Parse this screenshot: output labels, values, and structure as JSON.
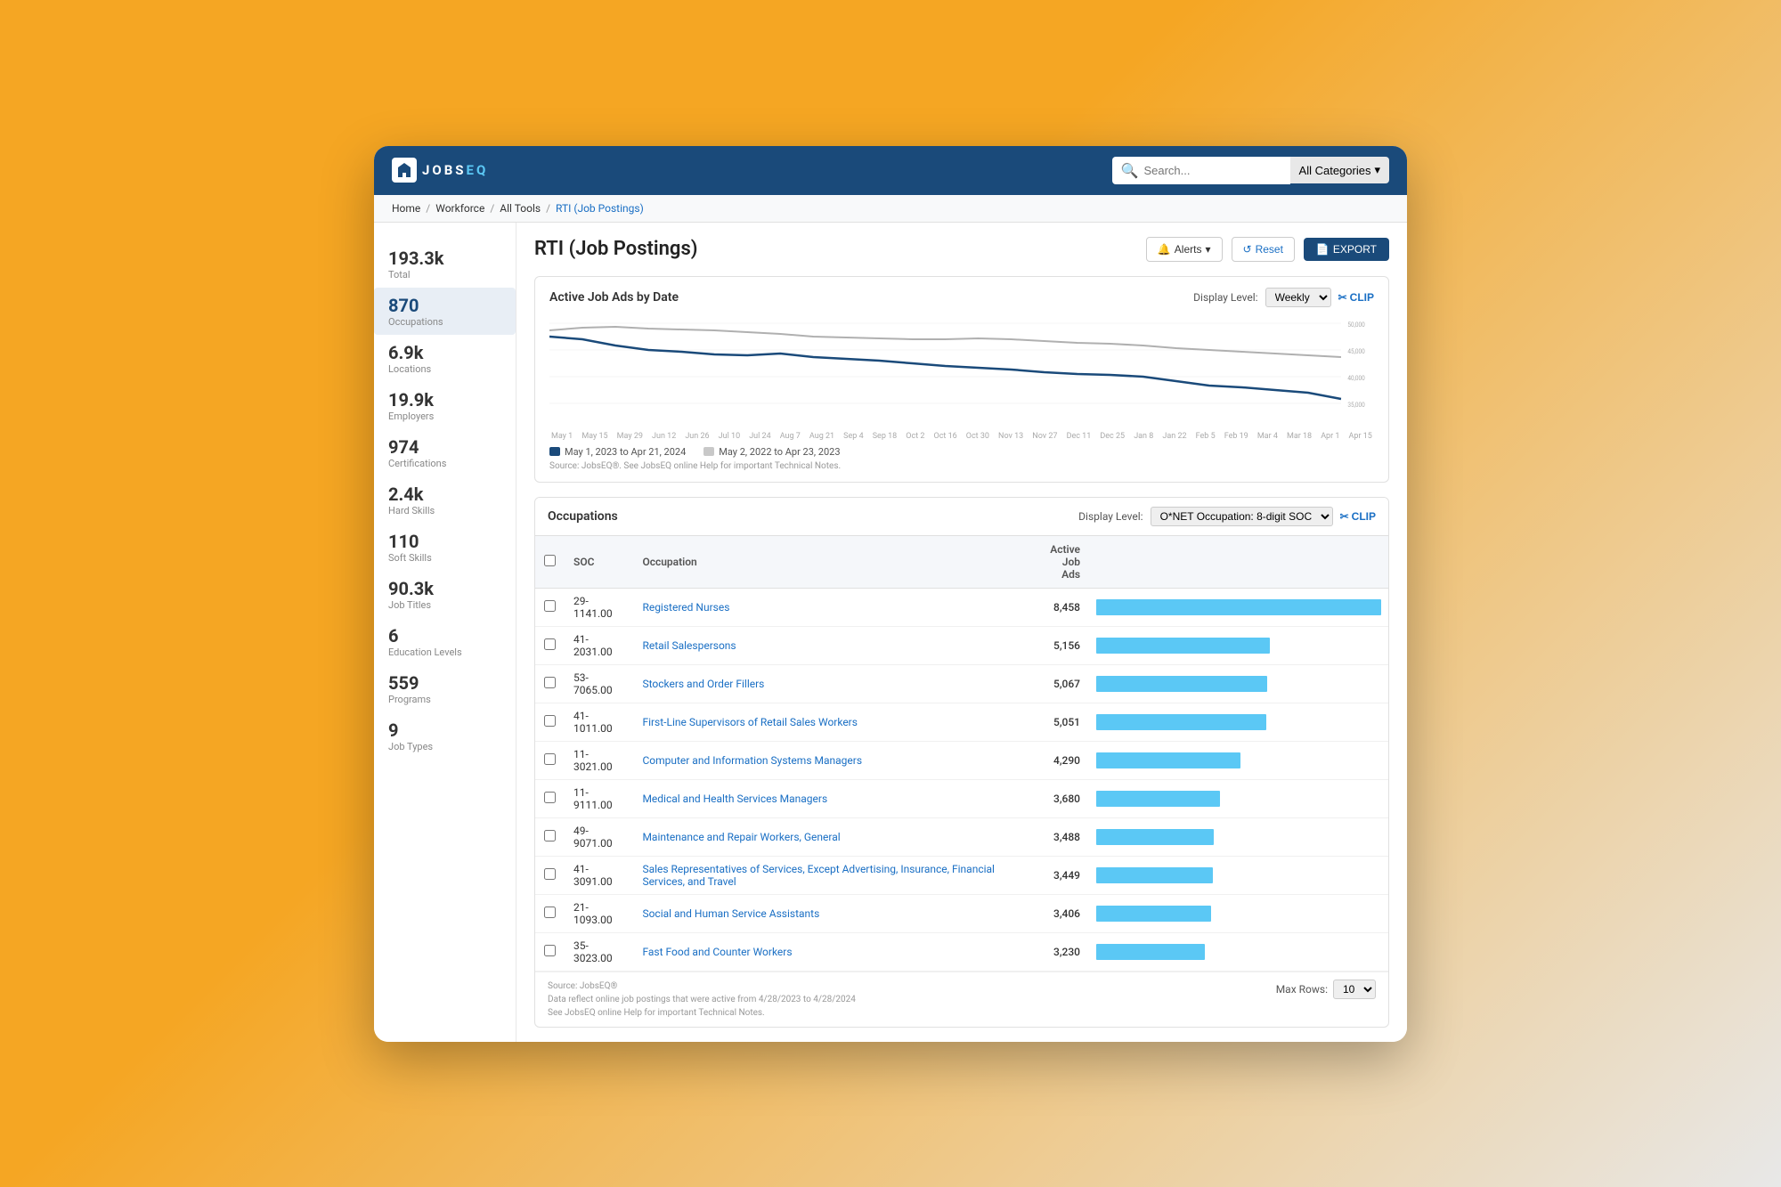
{
  "app": {
    "logo_text": "JOBS",
    "logo_eq": "EQ",
    "search_placeholder": "Search...",
    "search_category": "All Categories"
  },
  "breadcrumb": {
    "items": [
      "Home",
      "Workforce",
      "All Tools",
      "RTI (Job Postings)"
    ]
  },
  "page": {
    "title": "RTI (Job Postings)",
    "alerts_label": "Alerts",
    "reset_label": "Reset",
    "export_label": "EXPORT"
  },
  "sidebar": {
    "items": [
      {
        "value": "193.3k",
        "label": "Total"
      },
      {
        "value": "870",
        "label": "Occupations",
        "active": true
      },
      {
        "value": "6.9k",
        "label": "Locations"
      },
      {
        "value": "19.9k",
        "label": "Employers"
      },
      {
        "value": "974",
        "label": "Certifications"
      },
      {
        "value": "2.4k",
        "label": "Hard Skills"
      },
      {
        "value": "110",
        "label": "Soft Skills"
      },
      {
        "value": "90.3k",
        "label": "Job Titles"
      },
      {
        "value": "6",
        "label": "Education Levels"
      },
      {
        "value": "559",
        "label": "Programs"
      },
      {
        "value": "9",
        "label": "Job Types"
      }
    ]
  },
  "chart": {
    "title": "Active Job Ads by Date",
    "display_level_label": "Display Level:",
    "display_level_value": "Weekly",
    "clip_label": "CLIP",
    "legend": [
      {
        "color": "#1a4a7a",
        "text": "May 1, 2023 to Apr 21, 2024"
      },
      {
        "color": "#c8c8c8",
        "text": "May 2, 2022 to Apr 23, 2023"
      }
    ],
    "source": "Source: JobsEQ®. See JobsEQ online Help for important Technical Notes.",
    "y_axis": [
      "50,000",
      "45,000",
      "40,000",
      "35,000"
    ],
    "x_axis": [
      "May 1",
      "May 15",
      "May 29",
      "Jun 12",
      "Jun 26",
      "Jul 10",
      "Jul 24",
      "Aug 7",
      "Aug 21",
      "Sep 4",
      "Sep 18",
      "Oct 2",
      "Oct 16",
      "Oct 30",
      "Nov 13",
      "Nov 27",
      "Dec 11",
      "Dec 25",
      "Jan 8",
      "Jan 22",
      "Feb 5",
      "Feb 19",
      "Mar 4",
      "Mar 18",
      "Apr 1",
      "Apr 15"
    ]
  },
  "occupations": {
    "title": "Occupations",
    "display_level_label": "Display Level:",
    "display_level_value": "O*NET Occupation: 8-digit SOC",
    "clip_label": "CLIP",
    "columns": {
      "soc": "SOC",
      "occupation": "Occupation",
      "active_job_ads": "Active\nJob Ads"
    },
    "rows": [
      {
        "soc": "29-1141.00",
        "occupation": "Registered Nurses",
        "ads": "8,458",
        "bar_pct": 100
      },
      {
        "soc": "41-2031.00",
        "occupation": "Retail Salespersons",
        "ads": "5,156",
        "bar_pct": 61
      },
      {
        "soc": "53-7065.00",
        "occupation": "Stockers and Order Fillers",
        "ads": "5,067",
        "bar_pct": 60
      },
      {
        "soc": "41-1011.00",
        "occupation": "First-Line Supervisors of Retail Sales Workers",
        "ads": "5,051",
        "bar_pct": 59.8
      },
      {
        "soc": "11-3021.00",
        "occupation": "Computer and Information Systems Managers",
        "ads": "4,290",
        "bar_pct": 50.7
      },
      {
        "soc": "11-9111.00",
        "occupation": "Medical and Health Services Managers",
        "ads": "3,680",
        "bar_pct": 43.5
      },
      {
        "soc": "49-9071.00",
        "occupation": "Maintenance and Repair Workers, General",
        "ads": "3,488",
        "bar_pct": 41.3
      },
      {
        "soc": "41-3091.00",
        "occupation": "Sales Representatives of Services, Except Advertising, Insurance, Financial Services, and Travel",
        "ads": "3,449",
        "bar_pct": 40.8
      },
      {
        "soc": "21-1093.00",
        "occupation": "Social and Human Service Assistants",
        "ads": "3,406",
        "bar_pct": 40.3
      },
      {
        "soc": "35-3023.00",
        "occupation": "Fast Food and Counter Workers",
        "ads": "3,230",
        "bar_pct": 38.2
      }
    ],
    "footer": {
      "source": "Source: JobsEQ®",
      "note1": "Data reflect online job postings that were active from 4/28/2023 to 4/28/2024",
      "note2": "See JobsEQ online Help for important Technical Notes.",
      "max_rows_label": "Max Rows:",
      "max_rows_value": "10"
    }
  }
}
